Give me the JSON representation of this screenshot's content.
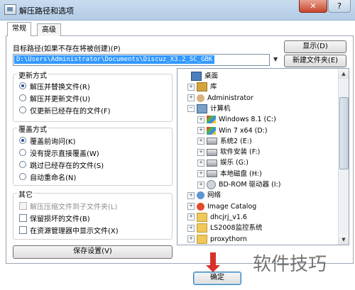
{
  "window": {
    "title": "解压路径和选项",
    "close_label": "✕",
    "help_label": "?"
  },
  "tabs": [
    {
      "label": "常规"
    },
    {
      "label": "高级"
    }
  ],
  "target": {
    "label": "目标路径(如果不存在将被创建)(P)",
    "value": "D:\\Users\\Administrator\\Documents\\Discuz_X3.2_SC_GBK",
    "show_button": "显示(D)",
    "new_folder_button": "新建文件夹(E)"
  },
  "update_mode": {
    "title": "更新方式",
    "options": [
      {
        "label": "解压并替换文件(R)",
        "selected": true
      },
      {
        "label": "解压并更新文件(U)",
        "selected": false
      },
      {
        "label": "仅更新已经存在的文件(F)",
        "selected": false
      }
    ]
  },
  "overwrite_mode": {
    "title": "覆盖方式",
    "options": [
      {
        "label": "覆盖前询问(K)",
        "selected": true
      },
      {
        "label": "没有提示直接覆盖(W)",
        "selected": false
      },
      {
        "label": "跳过已经存在的文件(S)",
        "selected": false
      },
      {
        "label": "自动重命名(N)",
        "selected": false
      }
    ]
  },
  "misc": {
    "title": "其它",
    "options": [
      {
        "label": "解压压缩文件到子文件夹(L)",
        "checked": false,
        "disabled": true
      },
      {
        "label": "保留损坏的文件(B)",
        "checked": false,
        "disabled": false
      },
      {
        "label": "在资源管理器中显示文件(X)",
        "checked": false,
        "disabled": false
      }
    ]
  },
  "save_button": "保存设置(V)",
  "tree": {
    "nodes": [
      {
        "label": "桌面",
        "icon": "desktop-icon",
        "expander": ""
      },
      {
        "label": "库",
        "icon": "library-icon",
        "expander": "+"
      },
      {
        "label": "Administrator",
        "icon": "user-icon",
        "expander": "+"
      },
      {
        "label": "计算机",
        "icon": "computer-icon",
        "expander": "−"
      },
      {
        "label": "Windows 8.1 (C:)",
        "icon": "windows-drive-icon",
        "expander": "+"
      },
      {
        "label": "Win 7 x64 (D:)",
        "icon": "windows-drive-icon",
        "expander": "+"
      },
      {
        "label": "系统2 (E:)",
        "icon": "drive-icon",
        "expander": "+"
      },
      {
        "label": "软件安装 (F:)",
        "icon": "drive-icon",
        "expander": "+"
      },
      {
        "label": "娱乐 (G:)",
        "icon": "drive-icon",
        "expander": "+"
      },
      {
        "label": "本地磁盘 (H:)",
        "icon": "drive-icon",
        "expander": "+"
      },
      {
        "label": "BD-ROM 驱动器 (I:)",
        "icon": "cd-drive-icon",
        "expander": "+"
      },
      {
        "label": "网络",
        "icon": "network-icon",
        "expander": "+"
      },
      {
        "label": "Image Catalog",
        "icon": "image-catalog-icon",
        "expander": "+"
      },
      {
        "label": "dhcjrj_v1.6",
        "icon": "folder-icon",
        "expander": "+"
      },
      {
        "label": "LS2008监控系统",
        "icon": "folder-icon",
        "expander": "+"
      },
      {
        "label": "proxythorn",
        "icon": "folder-icon",
        "expander": "+"
      }
    ]
  },
  "ok_button": "确定",
  "watermark": "软件技巧"
}
